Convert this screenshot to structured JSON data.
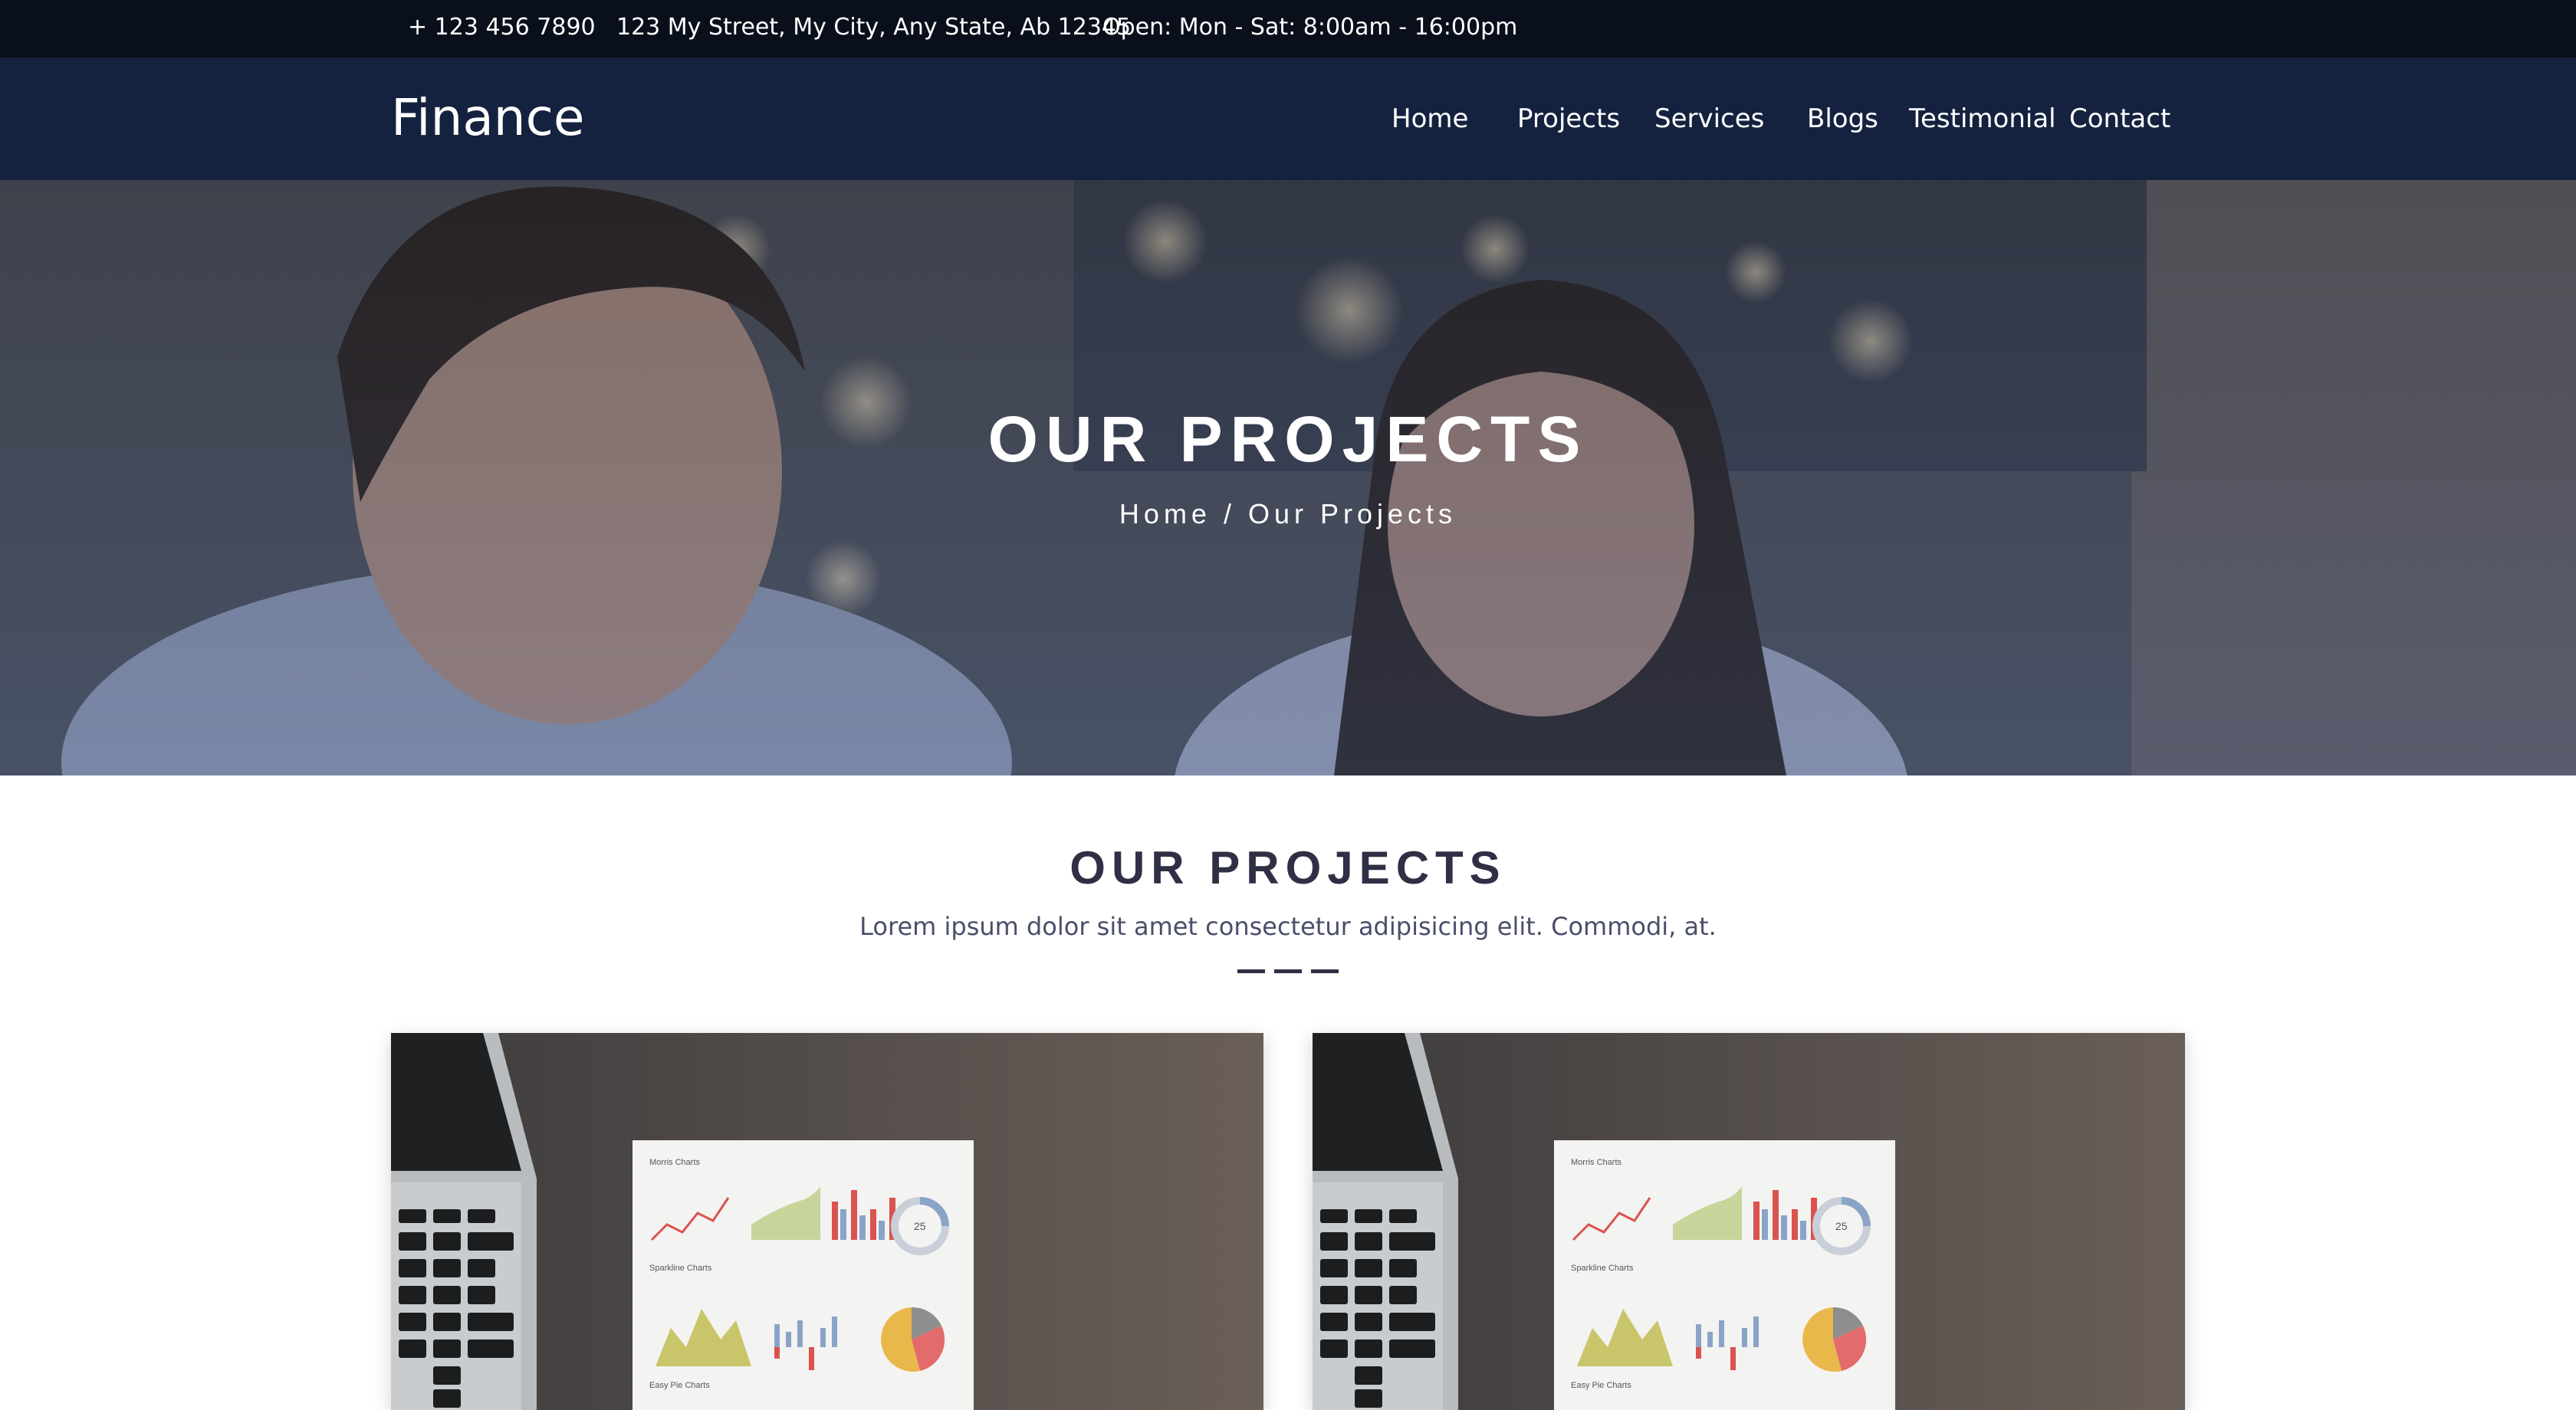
{
  "topbar": {
    "phone": "+ 123 456 7890",
    "address": "123 My Street, My City, Any State, Ab 12345",
    "hours": "Open: Mon - Sat: 8:00am - 16:00pm"
  },
  "navbar": {
    "brand": "Finance",
    "links": [
      "Home",
      "Projects",
      "Services",
      "Blogs",
      "Testimonial",
      "Contact"
    ]
  },
  "hero": {
    "title": "OUR PROJECTS",
    "breadcrumb_home": "Home",
    "breadcrumb_sep": "/",
    "breadcrumb_current": "Our Projects"
  },
  "section": {
    "title": "OUR PROJECTS",
    "subtitle": "Lorem ipsum dolor sit amet consectetur adipisicing elit. Commodi, at."
  },
  "cards": [
    {
      "image": "laptop-with-financial-charts-photo",
      "sheet_heading_1": "Morris Charts",
      "sheet_heading_2": "Sparkline Charts",
      "sheet_heading_3": "Easy Pie Charts",
      "badge": "25"
    },
    {
      "image": "laptop-with-financial-charts-photo",
      "sheet_heading_1": "Morris Charts",
      "sheet_heading_2": "Sparkline Charts",
      "sheet_heading_3": "Easy Pie Charts",
      "badge": "25"
    }
  ],
  "colors": {
    "topbar_bg": "#0a0f1c",
    "navbar_bg": "#15223f",
    "heading": "#2f2f45",
    "subtext": "#4b4e6b"
  }
}
